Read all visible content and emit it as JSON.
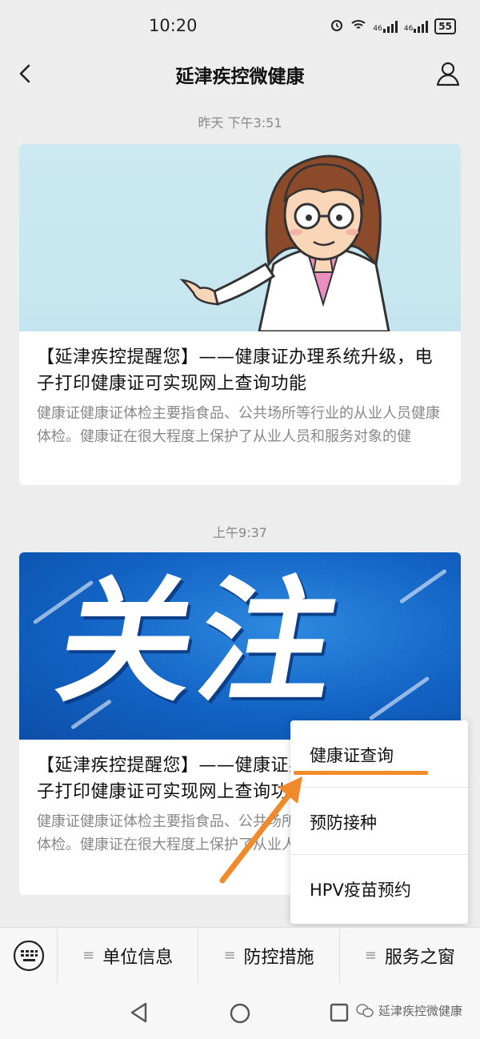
{
  "status_bar": {
    "time": "10:20",
    "battery": "55",
    "net1": "46",
    "net2": "46"
  },
  "nav": {
    "title": "延津疾控微健康",
    "back_icon": "chevron-left-icon",
    "profile_icon": "person-icon"
  },
  "messages": [
    {
      "timestamp": "昨天 下午3:51",
      "title": "【延津疾控提醒您】——健康证办理系统升级，电子打印健康证可实现网上查询功能",
      "desc": "健康证健康证体检主要指食品、公共场所等行业的从业人员健康体检。健康证在很大程度上保护了从业人员和服务对象的健"
    },
    {
      "timestamp": "上午9:37",
      "image_text": "关注",
      "title": "【延津疾控提醒您】——健康证办理系统升级，电子打印健康证可实现网上查询功能",
      "desc": "健康证健康证体检主要指食品、公共场所等行业的从业人员健康体检。健康证在很大程度上保护了从业人员和服务对象的健"
    }
  ],
  "popup_menu": {
    "items": [
      "健康证查询",
      "预防接种",
      "HPV疫苗预约"
    ]
  },
  "bottom_menu": {
    "keyboard_icon": "keyboard-icon",
    "items": [
      "单位信息",
      "防控措施",
      "服务之窗"
    ]
  },
  "watermark": "延津疾控微健康",
  "colors": {
    "accent_orange": "#f08a2a",
    "banner_blue": "#1262c3"
  }
}
